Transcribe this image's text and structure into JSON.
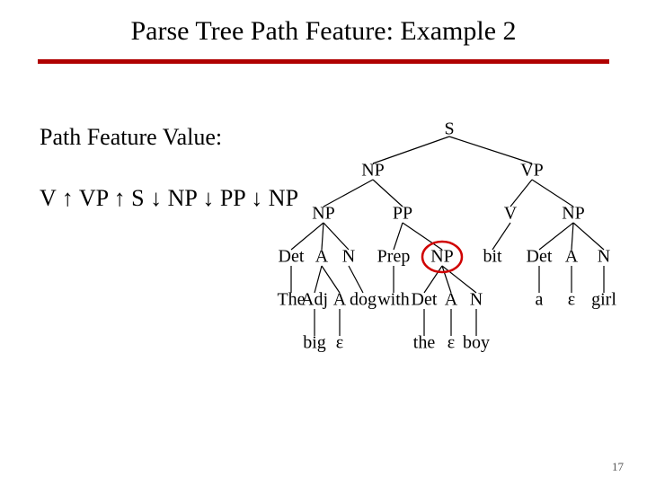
{
  "title": "Parse Tree Path Feature: Example 2",
  "label": "Path Feature Value:",
  "path_feature": "V ↑ VP ↑ S ↓ NP ↓ PP ↓ NP",
  "page_number": "17",
  "tree": {
    "S": "S",
    "NP_top": "NP",
    "VP": "VP",
    "NP_left": "NP",
    "PP": "PP",
    "V": "V",
    "NP_right": "NP",
    "Det1": "Det",
    "A1": "A",
    "N1": "N",
    "Prep": "Prep",
    "NP_obj": "NP",
    "bit": "bit",
    "Det3": "Det",
    "A3": "A",
    "N3": "N",
    "The": "The",
    "Adj": "Adj",
    "A_eps_parent": "A",
    "dog": "dog",
    "with": "with",
    "Det2": "Det",
    "A2": "A",
    "N2": "N",
    "a": "a",
    "eps_a3": "ε",
    "girl": "girl",
    "big": "big",
    "eps1": "ε",
    "the": "the",
    "eps2": "ε",
    "boy": "boy"
  }
}
